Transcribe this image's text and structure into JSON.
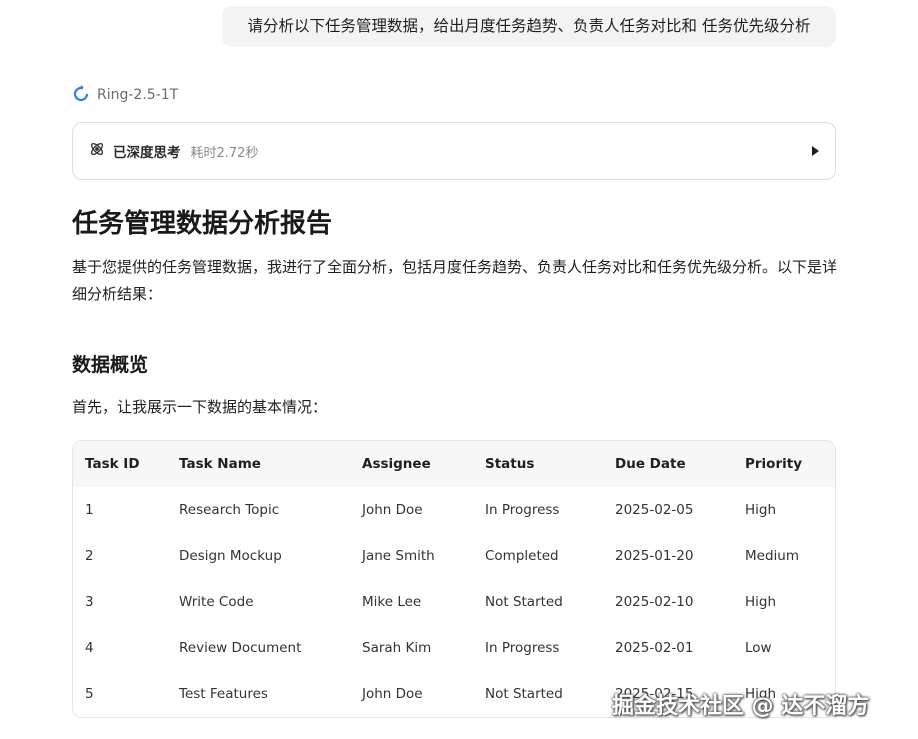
{
  "user_message": "请分析以下任务管理数据，给出月度任务趋势、负责人任务对比和 任务优先级分析",
  "model": {
    "name": "Ring-2.5-1T",
    "icon": "ring-logo-icon",
    "accent": "#2f7cf6"
  },
  "thinking": {
    "label": "已深度思考",
    "time": "耗时2.72秒",
    "icon": "atom-icon",
    "toggle_icon": "caret-right-icon"
  },
  "report": {
    "title": "任务管理数据分析报告",
    "intro": "基于您提供的任务管理数据，我进行了全面分析，包括月度任务趋势、负责人任务对比和任务优先级分析。以下是详细分析结果：",
    "section_title": "数据概览",
    "section_text": "首先，让我展示一下数据的基本情况："
  },
  "table": {
    "headers": [
      "Task ID",
      "Task Name",
      "Assignee",
      "Status",
      "Due Date",
      "Priority"
    ],
    "rows": [
      [
        "1",
        "Research Topic",
        "John Doe",
        "In Progress",
        "2025-02-05",
        "High"
      ],
      [
        "2",
        "Design Mockup",
        "Jane Smith",
        "Completed",
        "2025-01-20",
        "Medium"
      ],
      [
        "3",
        "Write Code",
        "Mike Lee",
        "Not Started",
        "2025-02-10",
        "High"
      ],
      [
        "4",
        "Review Document",
        "Sarah Kim",
        "In Progress",
        "2025-02-01",
        "Low"
      ],
      [
        "5",
        "Test Features",
        "John Doe",
        "Not Started",
        "2025-02-15",
        "High"
      ]
    ]
  },
  "watermark": "掘金技术社区 @ 达不溜方"
}
